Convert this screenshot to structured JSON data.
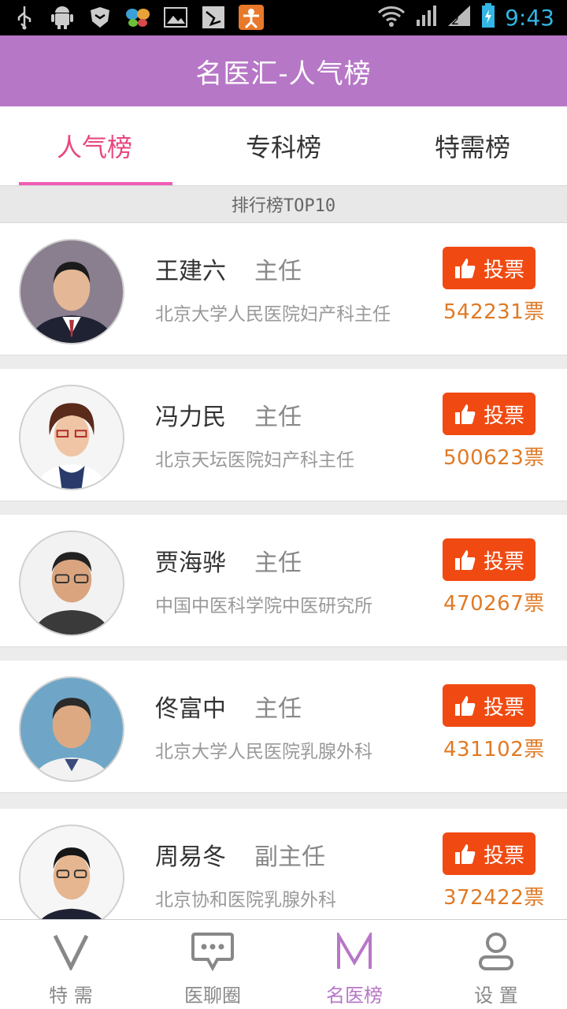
{
  "status_bar": {
    "time": "9:43",
    "left_icons": [
      "usb-icon",
      "android-icon",
      "shield-icon",
      "butterfly-icon",
      "image-icon",
      "app-icon",
      "game-icon"
    ],
    "right_icons": [
      "wifi-icon",
      "signal-icon",
      "signal-icon",
      "battery-icon"
    ]
  },
  "header": {
    "title": "名医汇-人气榜"
  },
  "tabs": [
    {
      "label": "人气榜",
      "active": true
    },
    {
      "label": "专科榜",
      "active": false
    },
    {
      "label": "特需榜",
      "active": false
    }
  ],
  "section": {
    "title": "排行榜TOP10"
  },
  "doctors": [
    {
      "name": "王建六",
      "title": "主任",
      "hospital": "北京大学人民医院妇产科主任",
      "vote_label": "投票",
      "votes": "542231票"
    },
    {
      "name": "冯力民",
      "title": "主任",
      "hospital": "北京天坛医院妇产科主任",
      "vote_label": "投票",
      "votes": "500623票"
    },
    {
      "name": "贾海骅",
      "title": "主任",
      "hospital": "中国中医科学院中医研究所",
      "vote_label": "投票",
      "votes": "470267票"
    },
    {
      "name": "佟富中",
      "title": "主任",
      "hospital": "北京大学人民医院乳腺外科",
      "vote_label": "投票",
      "votes": "431102票"
    },
    {
      "name": "周易冬",
      "title": "副主任",
      "hospital": "北京协和医院乳腺外科",
      "vote_label": "投票",
      "votes": "372422票"
    }
  ],
  "bottom_nav": [
    {
      "label": "特 需",
      "icon": "v-icon",
      "active": false
    },
    {
      "label": "医聊圈",
      "icon": "chat-bubble-icon",
      "active": false
    },
    {
      "label": "名医榜",
      "icon": "m-icon",
      "active": true
    },
    {
      "label": "设 置",
      "icon": "user-icon",
      "active": false
    }
  ],
  "colors": {
    "header": "#b777c7",
    "active_tab": "#e8477f",
    "vote_button": "#f04a12",
    "votes_text": "#e07a25"
  }
}
